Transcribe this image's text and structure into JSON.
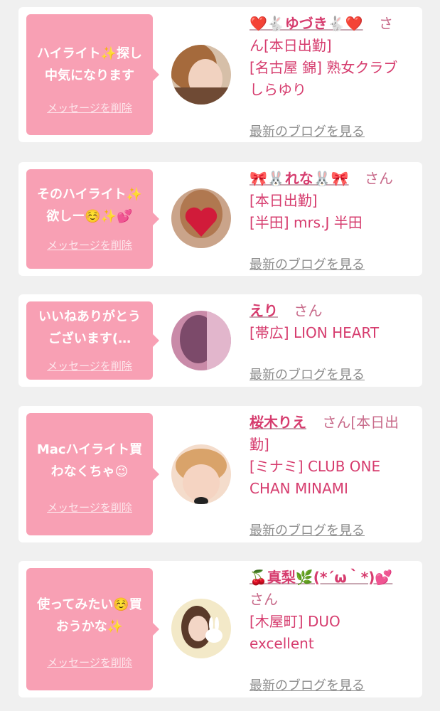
{
  "common": {
    "delete_label": "メッセージを削除",
    "blog_label": "最新のブログを見る"
  },
  "cards": [
    {
      "message_lines": [
        "ハイライト✨探し",
        "中気になります"
      ],
      "name": "❤️🐇ゆづき🐇❤️",
      "suffix_lines": [
        "さ",
        "ん[本日出勤]"
      ],
      "shop_lines": [
        "[名古屋 錦] 熟女クラブ",
        "しらゆり"
      ]
    },
    {
      "message_lines": [
        "そのハイライト✨",
        "欲しー☺️✨💕"
      ],
      "name": "🎀🐰れな🐰🎀",
      "suffix_lines": [
        "さん",
        "[本日出勤]"
      ],
      "shop_lines": [
        "[半田] mrs.J 半田"
      ]
    },
    {
      "message_lines": [
        "いいねありがとう",
        "ございます(…"
      ],
      "name": "えり",
      "suffix_lines": [
        "さん"
      ],
      "shop_lines": [
        "[帯広] LION HEART"
      ]
    },
    {
      "message_lines": [
        "Macハイライト買",
        "わなくちゃ😉"
      ],
      "name": "桜木りえ",
      "suffix_lines": [
        "さん[本日出",
        "勤]"
      ],
      "shop_lines": [
        "[ミナミ] CLUB ONE",
        "CHAN MINAMI"
      ]
    },
    {
      "message_lines": [
        "使ってみたい☺️買",
        "おうかな✨"
      ],
      "name": "🍒真梨🌿(*´ω｀*)💕",
      "suffix_lines": [
        "さん"
      ],
      "shop_lines": [
        "[木屋町] DUO",
        "excellent"
      ]
    }
  ]
}
